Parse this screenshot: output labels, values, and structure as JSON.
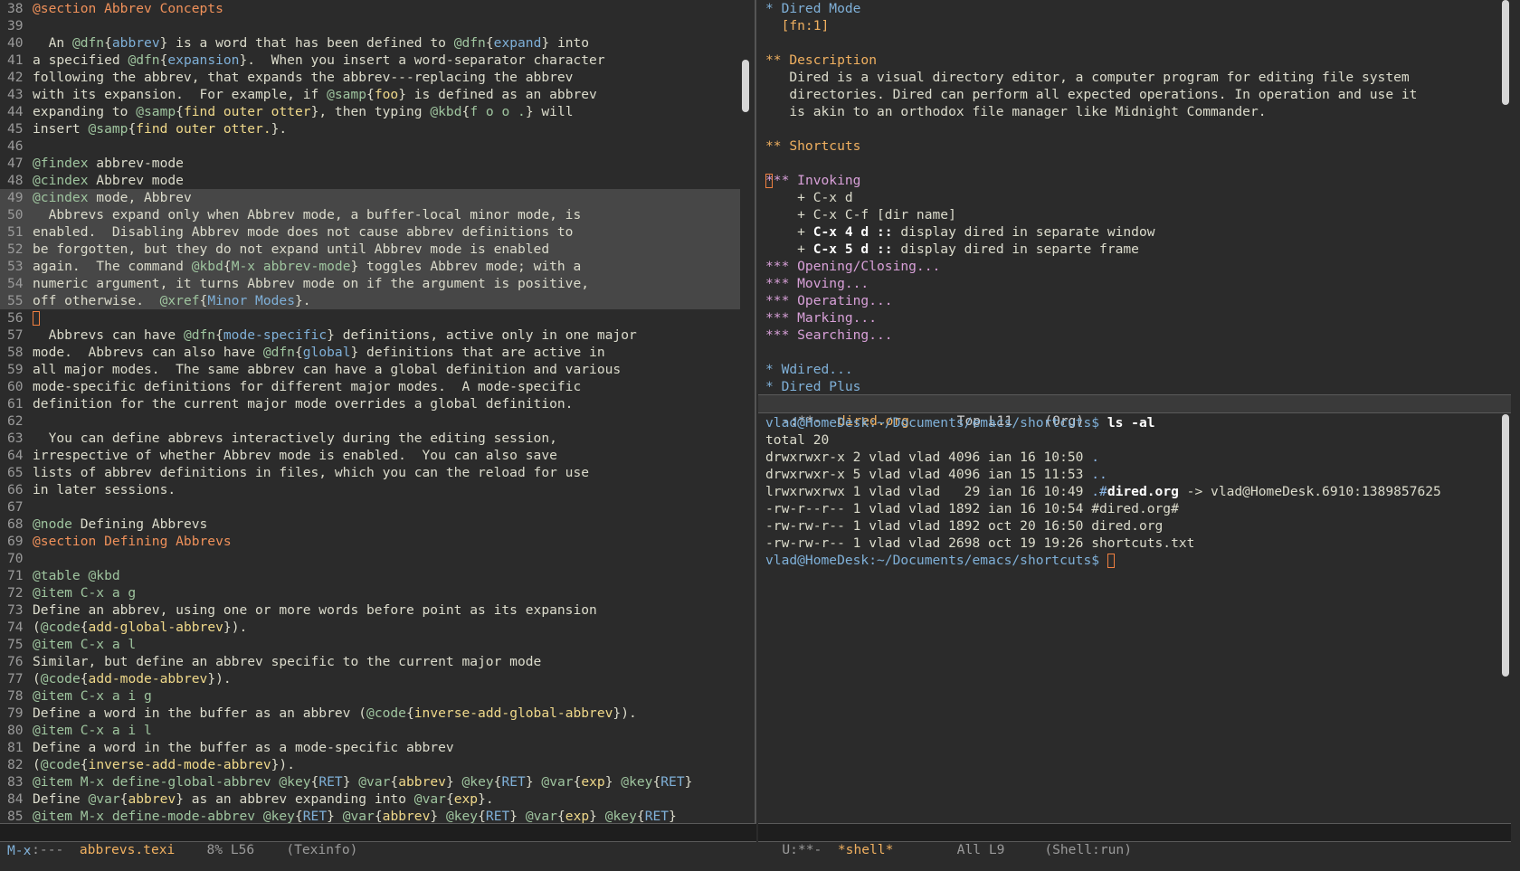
{
  "left_buffer": {
    "lines": [
      {
        "n": "38",
        "segs": [
          [
            "sec",
            "@section Abbrev Concepts"
          ]
        ]
      },
      {
        "n": "39",
        "segs": []
      },
      {
        "n": "40",
        "segs": [
          [
            "",
            "  An "
          ],
          [
            "kw",
            "@dfn"
          ],
          [
            "",
            "{"
          ],
          [
            "arg",
            "abbrev"
          ],
          [
            "",
            "} is a word that has been defined to "
          ],
          [
            "kw",
            "@dfn"
          ],
          [
            "",
            "{"
          ],
          [
            "arg",
            "expand"
          ],
          [
            "",
            "} into"
          ]
        ]
      },
      {
        "n": "41",
        "segs": [
          [
            "",
            "a specified "
          ],
          [
            "kw",
            "@dfn"
          ],
          [
            "",
            "{"
          ],
          [
            "arg",
            "expansion"
          ],
          [
            "",
            "}.  When you insert a word-separator character"
          ]
        ]
      },
      {
        "n": "42",
        "segs": [
          [
            "",
            "following the abbrev, that expands the abbrev---replacing the abbrev"
          ]
        ]
      },
      {
        "n": "43",
        "segs": [
          [
            "",
            "with its expansion.  For example, if "
          ],
          [
            "kw",
            "@samp"
          ],
          [
            "",
            "{"
          ],
          [
            "cod",
            "foo"
          ],
          [
            "",
            "} is defined as an abbrev"
          ]
        ]
      },
      {
        "n": "44",
        "segs": [
          [
            "",
            "expanding to "
          ],
          [
            "kw",
            "@samp"
          ],
          [
            "",
            "{"
          ],
          [
            "cod",
            "find outer otter"
          ],
          [
            "",
            "}, then typing "
          ],
          [
            "kw",
            "@kbd"
          ],
          [
            "",
            "{"
          ],
          [
            "kw",
            "f o o ."
          ],
          [
            "",
            "} will"
          ]
        ]
      },
      {
        "n": "45",
        "segs": [
          [
            "",
            "insert "
          ],
          [
            "kw",
            "@samp"
          ],
          [
            "",
            "{"
          ],
          [
            "cod",
            "find outer otter."
          ],
          [
            "",
            "}."
          ]
        ]
      },
      {
        "n": "46",
        "segs": []
      },
      {
        "n": "47",
        "segs": [
          [
            "kw",
            "@findex"
          ],
          [
            "",
            " abbrev-mode"
          ]
        ]
      },
      {
        "n": "48",
        "segs": [
          [
            "kw",
            "@cindex"
          ],
          [
            "",
            " Abbrev mode"
          ]
        ]
      },
      {
        "n": "49",
        "hl": true,
        "segs": [
          [
            "kw",
            "@cindex"
          ],
          [
            "",
            " mode, Abbrev"
          ]
        ]
      },
      {
        "n": "50",
        "hl": true,
        "segs": [
          [
            "",
            "  Abbrevs expand only when Abbrev mode, a buffer-local minor mode, is"
          ]
        ]
      },
      {
        "n": "51",
        "hl": true,
        "segs": [
          [
            "",
            "enabled.  Disabling Abbrev mode does not cause abbrev definitions to"
          ]
        ]
      },
      {
        "n": "52",
        "hl": true,
        "segs": [
          [
            "",
            "be forgotten, but they do not expand until Abbrev mode is enabled"
          ]
        ]
      },
      {
        "n": "53",
        "hl": true,
        "segs": [
          [
            "",
            "again.  The command "
          ],
          [
            "kw",
            "@kbd"
          ],
          [
            "",
            "{"
          ],
          [
            "kw",
            "M-x abbrev-mode"
          ],
          [
            "",
            "} toggles Abbrev mode; with a"
          ]
        ]
      },
      {
        "n": "54",
        "hl": true,
        "segs": [
          [
            "",
            "numeric argument, it turns Abbrev mode on if the argument is positive,"
          ]
        ]
      },
      {
        "n": "55",
        "hl": true,
        "segs": [
          [
            "",
            "off otherwise.  "
          ],
          [
            "kw",
            "@xref"
          ],
          [
            "",
            "{"
          ],
          [
            "arg",
            "Minor Modes"
          ],
          [
            "",
            "}."
          ]
        ]
      },
      {
        "n": "56",
        "cursor": true,
        "segs": []
      },
      {
        "n": "57",
        "segs": [
          [
            "",
            "  Abbrevs can have "
          ],
          [
            "kw",
            "@dfn"
          ],
          [
            "",
            "{"
          ],
          [
            "arg",
            "mode-specific"
          ],
          [
            "",
            "} definitions, active only in one major"
          ]
        ]
      },
      {
        "n": "58",
        "segs": [
          [
            "",
            "mode.  Abbrevs can also have "
          ],
          [
            "kw",
            "@dfn"
          ],
          [
            "",
            "{"
          ],
          [
            "arg",
            "global"
          ],
          [
            "",
            "} definitions that are active in"
          ]
        ]
      },
      {
        "n": "59",
        "segs": [
          [
            "",
            "all major modes.  The same abbrev can have a global definition and various"
          ]
        ]
      },
      {
        "n": "60",
        "segs": [
          [
            "",
            "mode-specific definitions for different major modes.  A mode-specific"
          ]
        ]
      },
      {
        "n": "61",
        "segs": [
          [
            "",
            "definition for the current major mode overrides a global definition."
          ]
        ]
      },
      {
        "n": "62",
        "segs": []
      },
      {
        "n": "63",
        "segs": [
          [
            "",
            "  You can define abbrevs interactively during the editing session,"
          ]
        ]
      },
      {
        "n": "64",
        "segs": [
          [
            "",
            "irrespective of whether Abbrev mode is enabled.  You can also save"
          ]
        ]
      },
      {
        "n": "65",
        "segs": [
          [
            "",
            "lists of abbrev definitions in files, which you can the reload for use"
          ]
        ]
      },
      {
        "n": "66",
        "segs": [
          [
            "",
            "in later sessions."
          ]
        ]
      },
      {
        "n": "67",
        "segs": []
      },
      {
        "n": "68",
        "segs": [
          [
            "kw",
            "@node"
          ],
          [
            "",
            " Defining Abbrevs"
          ]
        ]
      },
      {
        "n": "69",
        "segs": [
          [
            "sec",
            "@section Defining Abbrevs"
          ]
        ]
      },
      {
        "n": "70",
        "segs": []
      },
      {
        "n": "71",
        "segs": [
          [
            "kw",
            "@table"
          ],
          [
            "",
            " "
          ],
          [
            "kw",
            "@kbd"
          ]
        ]
      },
      {
        "n": "72",
        "segs": [
          [
            "kw",
            "@item C-x a g"
          ]
        ]
      },
      {
        "n": "73",
        "segs": [
          [
            "",
            "Define an abbrev, using one or more words before point as its expansion"
          ]
        ]
      },
      {
        "n": "74",
        "segs": [
          [
            "",
            "("
          ],
          [
            "kw",
            "@code"
          ],
          [
            "",
            "{"
          ],
          [
            "cod",
            "add-global-abbrev"
          ],
          [
            "",
            "})."
          ]
        ]
      },
      {
        "n": "75",
        "segs": [
          [
            "kw",
            "@item C-x a l"
          ]
        ]
      },
      {
        "n": "76",
        "segs": [
          [
            "",
            "Similar, but define an abbrev specific to the current major mode"
          ]
        ]
      },
      {
        "n": "77",
        "segs": [
          [
            "",
            "("
          ],
          [
            "kw",
            "@code"
          ],
          [
            "",
            "{"
          ],
          [
            "cod",
            "add-mode-abbrev"
          ],
          [
            "",
            "})."
          ]
        ]
      },
      {
        "n": "78",
        "segs": [
          [
            "kw",
            "@item C-x a i g"
          ]
        ]
      },
      {
        "n": "79",
        "segs": [
          [
            "",
            "Define a word in the buffer as an abbrev ("
          ],
          [
            "kw",
            "@code"
          ],
          [
            "",
            "{"
          ],
          [
            "cod",
            "inverse-add-global-abbrev"
          ],
          [
            "",
            "})."
          ]
        ]
      },
      {
        "n": "80",
        "segs": [
          [
            "kw",
            "@item C-x a i l"
          ]
        ]
      },
      {
        "n": "81",
        "segs": [
          [
            "",
            "Define a word in the buffer as a mode-specific abbrev"
          ]
        ]
      },
      {
        "n": "82",
        "segs": [
          [
            "",
            "("
          ],
          [
            "kw",
            "@code"
          ],
          [
            "",
            "{"
          ],
          [
            "cod",
            "inverse-add-mode-abbrev"
          ],
          [
            "",
            "})."
          ]
        ]
      },
      {
        "n": "83",
        "segs": [
          [
            "kw",
            "@item M-x define-global-abbrev "
          ],
          [
            "kw",
            "@key"
          ],
          [
            "",
            "{"
          ],
          [
            "arg",
            "RET"
          ],
          [
            "",
            "} "
          ],
          [
            "kw",
            "@var"
          ],
          [
            "",
            "{"
          ],
          [
            "cod",
            "abbrev"
          ],
          [
            "",
            "} "
          ],
          [
            "kw",
            "@key"
          ],
          [
            "",
            "{"
          ],
          [
            "arg",
            "RET"
          ],
          [
            "",
            "} "
          ],
          [
            "kw",
            "@var"
          ],
          [
            "",
            "{"
          ],
          [
            "cod",
            "exp"
          ],
          [
            "",
            "} "
          ],
          [
            "kw",
            "@key"
          ],
          [
            "",
            "{"
          ],
          [
            "arg",
            "RET"
          ],
          [
            "",
            "}"
          ]
        ]
      },
      {
        "n": "84",
        "segs": [
          [
            "",
            "Define "
          ],
          [
            "kw",
            "@var"
          ],
          [
            "",
            "{"
          ],
          [
            "cod",
            "abbrev"
          ],
          [
            "",
            "} as an abbrev expanding into "
          ],
          [
            "kw",
            "@var"
          ],
          [
            "",
            "{"
          ],
          [
            "cod",
            "exp"
          ],
          [
            "",
            "}."
          ]
        ]
      },
      {
        "n": "85",
        "segs": [
          [
            "kw",
            "@item M-x define-mode-abbrev "
          ],
          [
            "kw",
            "@key"
          ],
          [
            "",
            "{"
          ],
          [
            "arg",
            "RET"
          ],
          [
            "",
            "} "
          ],
          [
            "kw",
            "@var"
          ],
          [
            "",
            "{"
          ],
          [
            "cod",
            "abbrev"
          ],
          [
            "",
            "} "
          ],
          [
            "kw",
            "@key"
          ],
          [
            "",
            "{"
          ],
          [
            "arg",
            "RET"
          ],
          [
            "",
            "} "
          ],
          [
            "kw",
            "@var"
          ],
          [
            "",
            "{"
          ],
          [
            "cod",
            "exp"
          ],
          [
            "",
            "} "
          ],
          [
            "kw",
            "@key"
          ],
          [
            "",
            "{"
          ],
          [
            "arg",
            "RET"
          ],
          [
            "",
            "}"
          ]
        ]
      }
    ],
    "modeline": {
      "status": " -:---  ",
      "name": "abbrevs.texi",
      "pos": "    8% L56    ",
      "mode": "(Texinfo)"
    }
  },
  "right_top_buffer": {
    "lines": [
      {
        "segs": [
          [
            "org1",
            "* Dired Mode"
          ]
        ]
      },
      {
        "segs": [
          [
            "org2",
            "  [fn:1]"
          ]
        ]
      },
      {
        "segs": []
      },
      {
        "segs": [
          [
            "org2",
            "** Description"
          ]
        ]
      },
      {
        "segs": [
          [
            "",
            "   Dired is a visual directory editor, a computer program for editing file system"
          ]
        ]
      },
      {
        "segs": [
          [
            "",
            "   directories. Dired can perform all expected operations. In operation and use it"
          ]
        ]
      },
      {
        "segs": [
          [
            "",
            "   is akin to an orthodox file manager like Midnight Commander."
          ]
        ]
      },
      {
        "segs": []
      },
      {
        "segs": [
          [
            "org2",
            "** Shortcuts"
          ]
        ]
      },
      {
        "segs": []
      },
      {
        "cursor": true,
        "segs": [
          [
            "org3",
            "** Invoking"
          ]
        ]
      },
      {
        "segs": [
          [
            "",
            "    + C-x d"
          ]
        ]
      },
      {
        "segs": [
          [
            "",
            "    + C-x C-f [dir name]"
          ]
        ]
      },
      {
        "segs": [
          [
            "",
            "    + "
          ],
          [
            "bold",
            "C-x 4 d"
          ],
          [
            "bold",
            " ::"
          ],
          [
            "",
            " display dired in separate window"
          ]
        ]
      },
      {
        "segs": [
          [
            "",
            "    + "
          ],
          [
            "bold",
            "C-x 5 d"
          ],
          [
            "bold",
            " ::"
          ],
          [
            "",
            " display dired in separte frame"
          ]
        ]
      },
      {
        "segs": [
          [
            "org3",
            "*** Opening/Closing..."
          ]
        ]
      },
      {
        "segs": [
          [
            "org3",
            "*** Moving..."
          ]
        ]
      },
      {
        "segs": [
          [
            "org3",
            "*** Operating..."
          ]
        ]
      },
      {
        "segs": [
          [
            "org3",
            "*** Marking..."
          ]
        ]
      },
      {
        "segs": [
          [
            "org3",
            "*** Searching..."
          ]
        ]
      },
      {
        "segs": []
      },
      {
        "segs": [
          [
            "org1",
            "* Wdired..."
          ]
        ]
      },
      {
        "segs": [
          [
            "org1",
            "* Dired Plus"
          ]
        ]
      }
    ],
    "modeline": {
      "status": " -:**-  ",
      "name": "dired.org",
      "pos": "      Top L11    ",
      "mode": "(Org)"
    }
  },
  "shell_buffer": {
    "lines": [
      {
        "segs": [
          [
            "prompt",
            "vlad@HomeDesk:~/Documents/emacs/shortcuts$ "
          ],
          [
            "bold",
            "ls -al"
          ]
        ]
      },
      {
        "segs": [
          [
            "",
            "total 20"
          ]
        ]
      },
      {
        "segs": [
          [
            "",
            "drwxrwxr-x 2 vlad vlad 4096 ian 16 10:50 "
          ],
          [
            "dir",
            "."
          ]
        ]
      },
      {
        "segs": [
          [
            "",
            "drwxrwxr-x 5 vlad vlad 4096 ian 15 11:53 "
          ],
          [
            "dir",
            ".."
          ]
        ]
      },
      {
        "segs": [
          [
            "",
            "lrwxrwxrwx 1 vlad vlad   29 ian 16 10:49 "
          ],
          [
            "dir",
            ".#"
          ],
          [
            "bold",
            "dired.org"
          ],
          [
            "",
            " -> vlad@HomeDesk.6910:1389857625"
          ]
        ]
      },
      {
        "segs": [
          [
            "",
            "-rw-r--r-- 1 vlad vlad 1892 ian 16 10:54 #dired.org#"
          ]
        ]
      },
      {
        "segs": [
          [
            "",
            "-rw-rw-r-- 1 vlad vlad 1892 oct 20 16:50 dired.org"
          ]
        ]
      },
      {
        "segs": [
          [
            "",
            "-rw-rw-r-- 1 vlad vlad 2698 oct 19 19:26 shortcuts.txt"
          ]
        ]
      },
      {
        "cursorEnd": true,
        "segs": [
          [
            "prompt",
            "vlad@HomeDesk:~/Documents/emacs/shortcuts$ "
          ]
        ]
      }
    ],
    "modeline": {
      "status": " U:**-  ",
      "name": "*shell*",
      "pos": "        All L9     ",
      "mode": "(Shell:run)"
    }
  },
  "minibuffer": {
    "text": "M-x"
  },
  "colors": {
    "background": "#2b2b2b",
    "keyword": "#9fc59f",
    "section": "#f0915a",
    "link": "#7fb0d8",
    "code": "#f0d98a"
  }
}
